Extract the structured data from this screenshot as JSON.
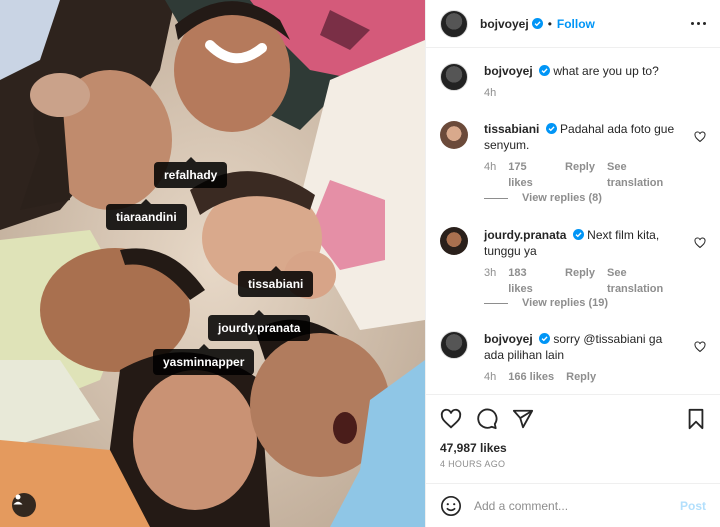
{
  "photo": {
    "tags": [
      {
        "name": "tag-refalhady",
        "label": "refalhady"
      },
      {
        "name": "tag-tiaraandini",
        "label": "tiaraandini"
      },
      {
        "name": "tag-tissabiani",
        "label": "tissabiani"
      },
      {
        "name": "tag-jourdy",
        "label": "jourdy.pranata"
      },
      {
        "name": "tag-yasminnapper",
        "label": "yasminnapper"
      }
    ],
    "user_tag_icon": "person-icon"
  },
  "header": {
    "username": "bojvoyej",
    "verified_icon": "verified-badge-icon",
    "separator": "•",
    "follow_label": "Follow",
    "more_icon": "more-options-icon"
  },
  "comments": [
    {
      "username": "bojvoyej",
      "text": "what are you up to?",
      "time": "4h",
      "likes": "",
      "reply": "",
      "translate": ""
    },
    {
      "username": "tissabiani",
      "text": "Padahal ada foto gue senyum.",
      "time": "4h",
      "likes": "175 likes",
      "reply": "Reply",
      "translate": "See translation",
      "view_replies": "View replies (8)"
    },
    {
      "username": "jourdy.pranata",
      "text": "Next film kita, tunggu ya",
      "time": "3h",
      "likes": "183 likes",
      "reply": "Reply",
      "translate": "See translation",
      "view_replies": "View replies (19)"
    },
    {
      "username": "bojvoyej",
      "text": "sorry @tissabiani ga ada pilihan lain",
      "time": "4h",
      "likes": "166 likes",
      "reply": "Reply",
      "translate": ""
    }
  ],
  "actions": {
    "like_icon": "heart-icon",
    "comment_icon": "comment-icon",
    "share_icon": "share-icon",
    "save_icon": "bookmark-icon",
    "likes": "47,987 likes",
    "posted_ago": "4 HOURS AGO"
  },
  "add_comment": {
    "emoji_icon": "emoji-icon",
    "placeholder": "Add a comment...",
    "post_label": "Post"
  },
  "colors": {
    "accent": "#0095f6",
    "muted": "#8e8e8e",
    "text": "#262626",
    "post_disabled": "#b2dffc"
  }
}
